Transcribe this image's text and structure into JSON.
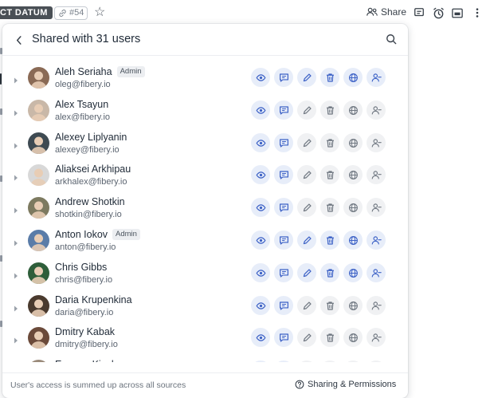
{
  "topbar": {
    "db_badge": "CT DATUM",
    "entity_id": "#54",
    "share_label": "Share"
  },
  "popover": {
    "title": "Shared with 31 users",
    "footer_note": "User's access is summed up across all sources",
    "footer_link": "Sharing & Permissions",
    "users": [
      {
        "name": "Aleh Seriaha",
        "email": "oleg@fibery.io",
        "badge": "Admin",
        "avatar_color": "#8a6a55",
        "perms": [
          1,
          1,
          1,
          1,
          1,
          1
        ]
      },
      {
        "name": "Alex Tsayun",
        "email": "alex@fibery.io",
        "badge": "",
        "avatar_color": "#c9b8a8",
        "perms": [
          1,
          1,
          0,
          0,
          0,
          0
        ]
      },
      {
        "name": "Alexey Liplyanin",
        "email": "alexey@fibery.io",
        "badge": "",
        "avatar_color": "#3e4a52",
        "perms": [
          1,
          1,
          0,
          0,
          0,
          0
        ]
      },
      {
        "name": "Aliaksei Arkhipau",
        "email": "arkhalex@fibery.io",
        "badge": "",
        "avatar_color": "#d8d8d8",
        "perms": [
          1,
          1,
          0,
          0,
          0,
          0
        ]
      },
      {
        "name": "Andrew Shotkin",
        "email": "shotkin@fibery.io",
        "badge": "",
        "avatar_color": "#7d7a60",
        "perms": [
          1,
          1,
          0,
          0,
          0,
          0
        ]
      },
      {
        "name": "Anton Iokov",
        "email": "anton@fibery.io",
        "badge": "Admin",
        "avatar_color": "#5a7ca8",
        "perms": [
          1,
          1,
          1,
          1,
          1,
          1
        ]
      },
      {
        "name": "Chris Gibbs",
        "email": "chris@fibery.io",
        "badge": "",
        "avatar_color": "#2e5e3a",
        "perms": [
          1,
          1,
          1,
          1,
          1,
          1
        ]
      },
      {
        "name": "Daria Krupenkina",
        "email": "daria@fibery.io",
        "badge": "",
        "avatar_color": "#4a3a2e",
        "perms": [
          1,
          1,
          0,
          0,
          0,
          0
        ]
      },
      {
        "name": "Dmitry Kabak",
        "email": "dmitry@fibery.io",
        "badge": "",
        "avatar_color": "#6b4a3a",
        "perms": [
          1,
          1,
          0,
          0,
          0,
          0
        ]
      },
      {
        "name": "Eugene Kisel",
        "email": "",
        "badge": "",
        "avatar_color": "#9a8a7a",
        "perms": [
          1,
          1,
          0,
          0,
          0,
          0
        ]
      }
    ]
  },
  "colors": {
    "perm_on_bg": "#e7edf9",
    "perm_on_fg": "#3d62c6",
    "perm_off_bg": "#f0f1f3",
    "perm_off_fg": "#707882"
  },
  "perm_icons": [
    "eye-icon",
    "comment-icon",
    "pencil-icon",
    "trash-icon",
    "globe-icon",
    "user-share-icon"
  ]
}
